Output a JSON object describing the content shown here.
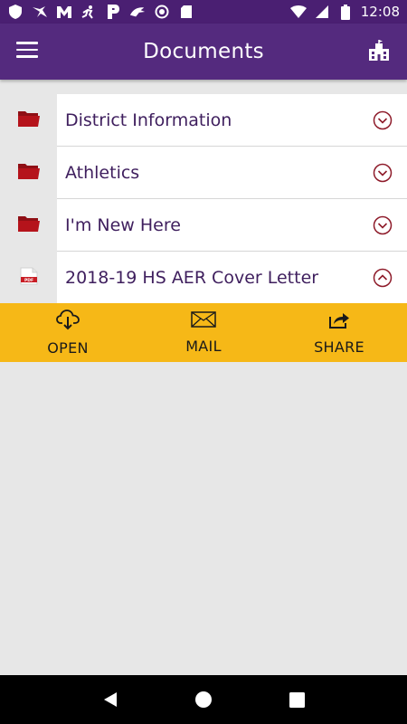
{
  "status_bar": {
    "time": "12:08",
    "icons": [
      "shield-icon",
      "eagle-icon",
      "m-logo-icon",
      "runner-icon",
      "p-logo-icon",
      "bird-icon",
      "record-icon",
      "sdcard-icon",
      "wifi-icon",
      "signal-icon",
      "battery-icon"
    ]
  },
  "app_bar": {
    "title": "Documents",
    "menu_icon": "hamburger-menu-icon",
    "right_icon": "school-building-icon"
  },
  "colors": {
    "status_bar": "#4a1f72",
    "app_bar": "#542a7e",
    "folder": "#b5131b",
    "label_text": "#3f1f5e",
    "chevron": "#8e1b2a",
    "action_bar": "#f6b817",
    "background": "#e7e7e7"
  },
  "documents": {
    "items": [
      {
        "label": "District Information",
        "icon": "folder-icon",
        "expanded": false
      },
      {
        "label": "Athletics",
        "icon": "folder-icon",
        "expanded": false
      },
      {
        "label": "I'm New Here",
        "icon": "folder-icon",
        "expanded": false
      },
      {
        "label": "2018-19 HS AER Cover Letter",
        "icon": "pdf-file-icon",
        "pdf_badge": "PDF",
        "expanded": true
      }
    ]
  },
  "actions": {
    "open_label": "OPEN",
    "mail_label": "MAIL",
    "share_label": "SHARE"
  },
  "nav_bar": {
    "icons": [
      "back-icon",
      "home-icon",
      "recents-icon"
    ]
  }
}
